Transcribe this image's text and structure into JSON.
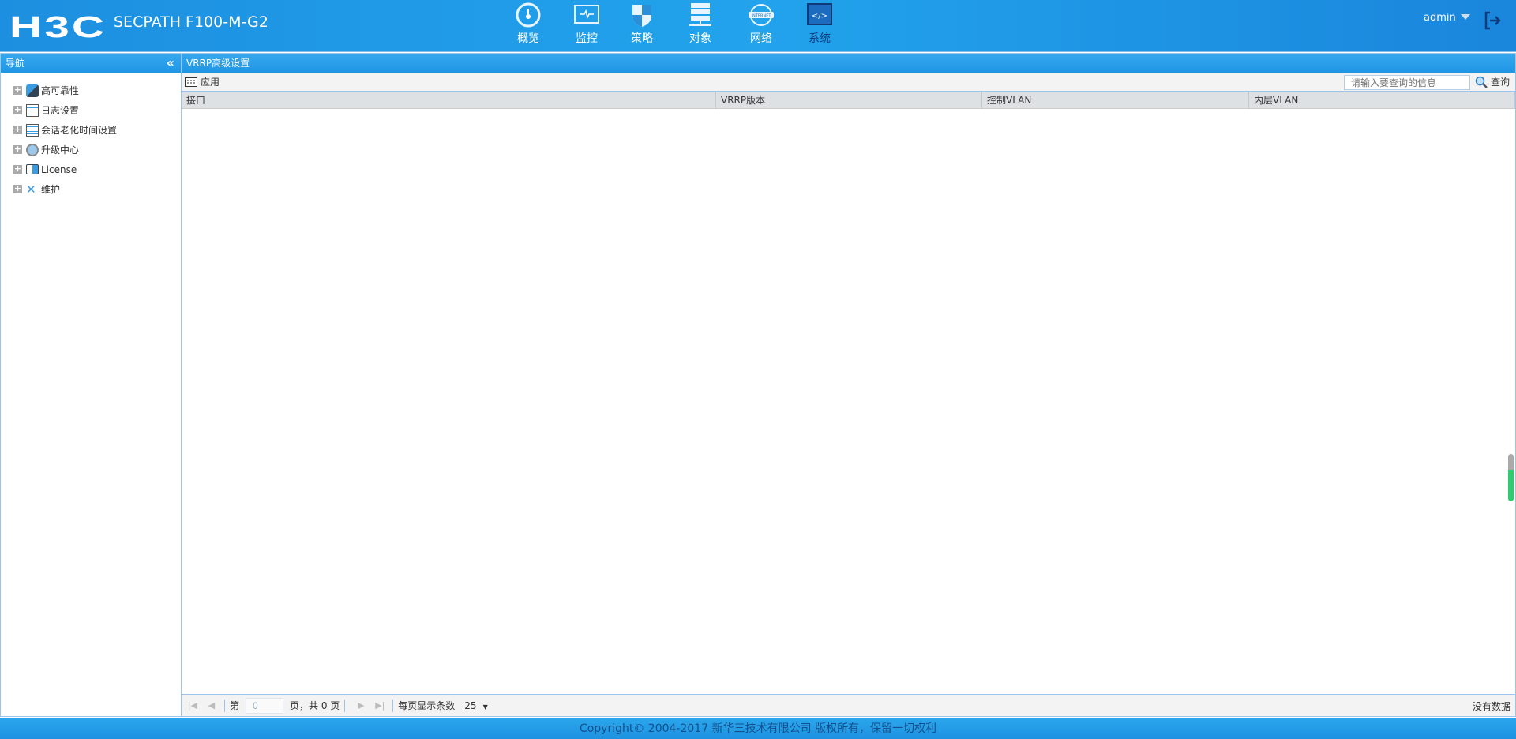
{
  "header": {
    "logo": "H3C",
    "product": "SECPATH F100-M-G2",
    "user": "admin",
    "nav": [
      {
        "label": "概览",
        "icon": "dashboard-icon"
      },
      {
        "label": "监控",
        "icon": "monitor-icon"
      },
      {
        "label": "策略",
        "icon": "shield-icon"
      },
      {
        "label": "对象",
        "icon": "server-icon"
      },
      {
        "label": "网络",
        "icon": "internet-globe-icon"
      },
      {
        "label": "系统",
        "icon": "code-window-icon"
      }
    ]
  },
  "sidebar": {
    "title": "导航",
    "collapse": "«",
    "items": [
      {
        "label": "高可靠性"
      },
      {
        "label": "日志设置"
      },
      {
        "label": "会话老化时间设置"
      },
      {
        "label": "升级中心"
      },
      {
        "label": "License"
      },
      {
        "label": "维护"
      }
    ]
  },
  "main": {
    "title": "VRRP高级设置",
    "apply": "应用",
    "search_placeholder": "请输入要查询的信息",
    "query": "查询",
    "columns": [
      "接口",
      "VRRP版本",
      "控制VLAN",
      "内层VLAN"
    ]
  },
  "pager": {
    "page_label": "第",
    "page_value": "0",
    "total": "页，共 0 页",
    "per_page_label": "每页显示条数",
    "per_page": "25",
    "status": "没有数据"
  },
  "footer": {
    "copyright": "Copyright© 2004-2017 新华三技术有限公司 版权所有，保留一切权利"
  }
}
